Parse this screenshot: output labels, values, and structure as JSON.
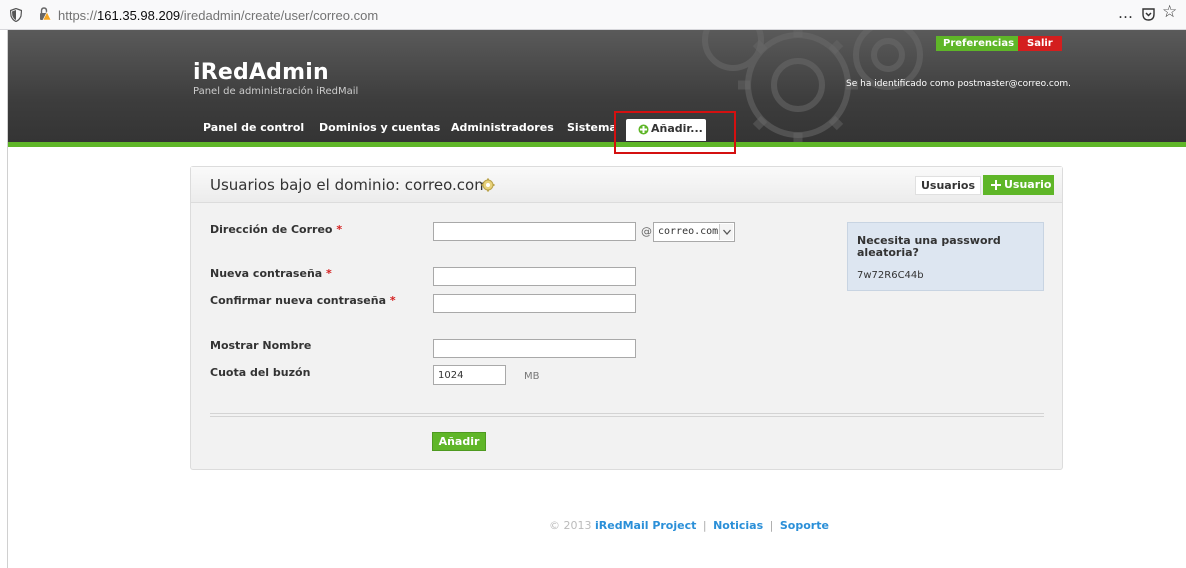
{
  "browser": {
    "url_prefix": "https://",
    "url_host": "161.35.98.209",
    "url_path": "/iredadmin/create/user/correo.com",
    "more_icon": "…",
    "pocket_icon": "pocket-icon",
    "star_icon": "☆"
  },
  "header": {
    "title": "iRedAdmin",
    "subtitle": "Panel de administración iRedMail",
    "preferences_label": "Preferencias",
    "logout_label": "Salir",
    "logged_in_text": "Se ha identificado como postmaster@correo.com.",
    "nav": [
      {
        "label": "Panel de control"
      },
      {
        "label": "Dominios y cuentas"
      },
      {
        "label": "Administradores"
      },
      {
        "label": "Sistema"
      }
    ],
    "add_label": "Añadir..."
  },
  "panel": {
    "title": "Usuarios bajo el dominio: correo.com",
    "tab_users": "Usuarios",
    "tab_add_user": "Usuario",
    "fields": {
      "email_label": "Dirección de Correo",
      "email_value": "",
      "at_sign": "@",
      "domain_value": "correo.com",
      "password_label": "Nueva contraseña",
      "confirm_label": "Confirmar nueva contraseña",
      "display_name_label": "Mostrar Nombre",
      "quota_label": "Cuota del buzón",
      "quota_value": "1024",
      "quota_unit": "MB",
      "required_mark": "*"
    },
    "random_password": {
      "question": "Necesita una password aleatoria?",
      "value": "7w72R6C44b"
    },
    "submit_label": "Añadir"
  },
  "footer": {
    "copyright": "© 2013",
    "project_link": "iRedMail Project",
    "news_link": "Noticias",
    "support_link": "Soporte",
    "separator": "|"
  },
  "colors": {
    "accent_green": "#5fb628",
    "danger_red": "#d41e1e",
    "link_blue": "#2a8fd8",
    "header_dark": "#3d3d3d"
  }
}
